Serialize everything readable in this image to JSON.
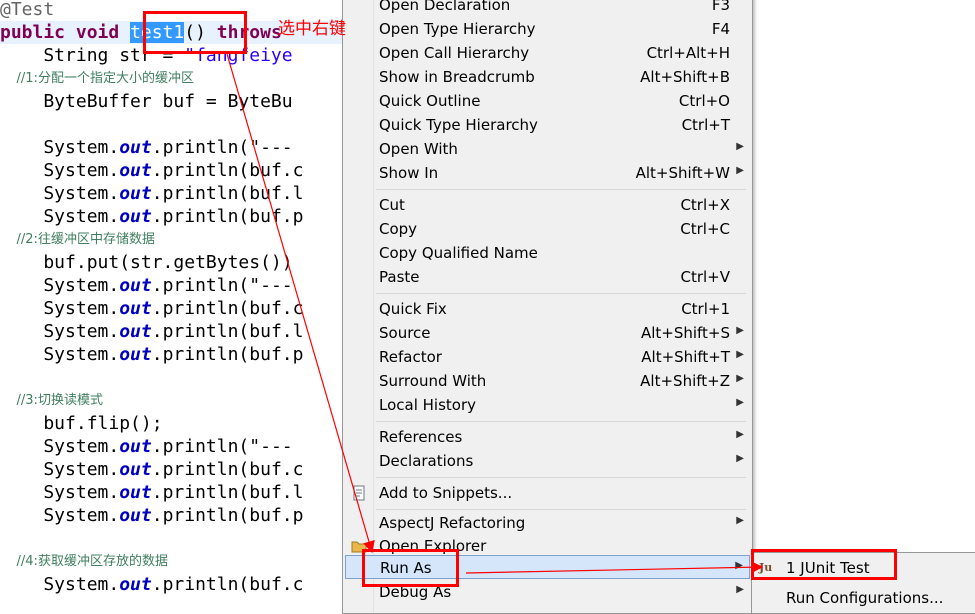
{
  "editor": {
    "annotation": "@Test",
    "method": {
      "kw1": "public",
      "kw2": "void",
      "name": "test1",
      "paren": "()",
      "throws": "throws"
    },
    "lines": {
      "l2": {
        "a": "    String str = ",
        "b": "\"fangfeiye"
      },
      "l3": "    //1:分配一个指定大小的缓冲区",
      "l4": "    ByteBuffer buf = ByteBu",
      "p1": {
        "a": "    System.",
        "b": "out",
        "c": ".println(\"---"
      },
      "p2": {
        "a": "    System.",
        "b": "out",
        "c": ".println(buf.c"
      },
      "p3": {
        "a": "    System.",
        "b": "out",
        "c": ".println(buf.l"
      },
      "p4": {
        "a": "    System.",
        "b": "out",
        "c": ".println(buf.p"
      },
      "c2": "    //2:往缓冲区中存储数据",
      "put": "    buf.put(str.getBytes())",
      "p5": {
        "a": "    System.",
        "b": "out",
        "c": ".println(\"---"
      },
      "p6": {
        "a": "    System.",
        "b": "out",
        "c": ".println(buf.c"
      },
      "p7": {
        "a": "    System.",
        "b": "out",
        "c": ".println(buf.l"
      },
      "p8": {
        "a": "    System.",
        "b": "out",
        "c": ".println(buf.p"
      },
      "c3": "    //3:切换读模式",
      "flip": "    buf.flip();",
      "p9": {
        "a": "    System.",
        "b": "out",
        "c": ".println(\"---"
      },
      "p10": {
        "a": "    System.",
        "b": "out",
        "c": ".println(buf.c"
      },
      "p11": {
        "a": "    System.",
        "b": "out",
        "c": ".println(buf.l"
      },
      "p12": {
        "a": "    System.",
        "b": "out",
        "c": ".println(buf.p"
      },
      "c4": "    //4:获取缓冲区存放的数据",
      "p13": {
        "a": "    System.",
        "b": "out",
        "c": ".println(buf.c"
      }
    }
  },
  "annotation_note": "选中右键",
  "context_menu": {
    "items": {
      "open_declaration": {
        "label": "Open Declaration",
        "acc": "F3"
      },
      "open_type_hierarchy": {
        "label": "Open Type Hierarchy",
        "acc": "F4"
      },
      "open_call_hierarchy": {
        "label": "Open Call Hierarchy",
        "acc": "Ctrl+Alt+H"
      },
      "show_in_breadcrumb": {
        "label": "Show in Breadcrumb",
        "acc": "Alt+Shift+B"
      },
      "quick_outline": {
        "label": "Quick Outline",
        "acc": "Ctrl+O"
      },
      "quick_type_hierarchy": {
        "label": "Quick Type Hierarchy",
        "acc": "Ctrl+T"
      },
      "open_with": {
        "label": "Open With",
        "acc": ""
      },
      "show_in": {
        "label": "Show In",
        "acc": "Alt+Shift+W"
      },
      "cut": {
        "label": "Cut",
        "acc": "Ctrl+X"
      },
      "copy": {
        "label": "Copy",
        "acc": "Ctrl+C"
      },
      "copy_qualified": {
        "label": "Copy Qualified Name",
        "acc": ""
      },
      "paste": {
        "label": "Paste",
        "acc": "Ctrl+V"
      },
      "quick_fix": {
        "label": "Quick Fix",
        "acc": "Ctrl+1"
      },
      "source": {
        "label": "Source",
        "acc": "Alt+Shift+S"
      },
      "refactor": {
        "label": "Refactor",
        "acc": "Alt+Shift+T"
      },
      "surround_with": {
        "label": "Surround With",
        "acc": "Alt+Shift+Z"
      },
      "local_history": {
        "label": "Local History",
        "acc": ""
      },
      "references": {
        "label": "References",
        "acc": ""
      },
      "declarations": {
        "label": "Declarations",
        "acc": ""
      },
      "add_snippets": {
        "label": "Add to Snippets...",
        "acc": ""
      },
      "aspectj": {
        "label": "AspectJ Refactoring",
        "acc": ""
      },
      "open_explorer": {
        "label": "Open Explorer",
        "acc": ""
      },
      "run_as": {
        "label": "Run As",
        "acc": ""
      },
      "debug_as": {
        "label": "Debug As",
        "acc": ""
      }
    }
  },
  "submenu": {
    "junit_icon": "Ju",
    "junit_test": "1 JUnit Test",
    "run_configurations": "Run Configurations..."
  },
  "colors": {
    "highlight": "#ff0000",
    "selection": "#3399ff",
    "keyword": "#7f0055"
  }
}
